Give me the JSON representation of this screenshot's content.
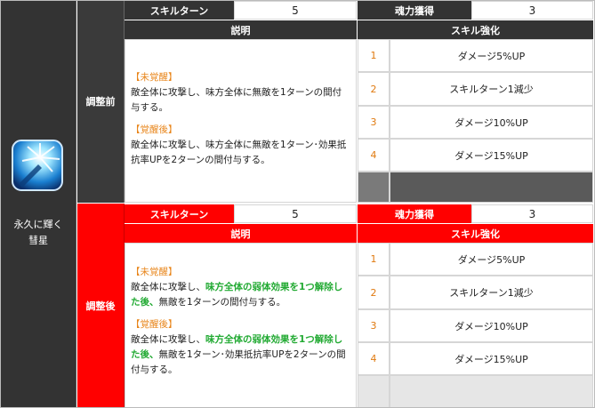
{
  "character": {
    "name_line1": "永久に輝く",
    "name_line2": "彗星"
  },
  "before": {
    "section_label": "調整前",
    "skill_turn_label": "スキルターン",
    "skill_turn_value": "5",
    "soul_gain_label": "魂力獲得",
    "soul_gain_value": "3",
    "desc_header": "説明",
    "boost_header": "スキル強化",
    "desc": {
      "tag1": "【未覚醒】",
      "text1": "敵全体に攻撃し、味方全体に無敵を1ターンの間付与する。",
      "tag2": "【覚醒後】",
      "text2": "敵全体に攻撃し、味方全体に無敵を1ターン･効果抵抗率UPを2ターンの間付与する。"
    },
    "boosts": [
      {
        "num": "1",
        "text": "ダメージ5%UP"
      },
      {
        "num": "2",
        "text": "スキルターン1減少"
      },
      {
        "num": "3",
        "text": "ダメージ10%UP"
      },
      {
        "num": "4",
        "text": "ダメージ15%UP"
      }
    ]
  },
  "after": {
    "section_label": "調整後",
    "skill_turn_label": "スキルターン",
    "skill_turn_value": "5",
    "soul_gain_label": "魂力獲得",
    "soul_gain_value": "3",
    "desc_header": "説明",
    "boost_header": "スキル強化",
    "desc": {
      "tag1": "【未覚醒】",
      "text1_a": "敵全体に攻撃し、",
      "text1_hl": "味方全体の弱体効果を1つ解除した後、",
      "text1_b": "無敵を1ターンの間付与する。",
      "tag2": "【覚醒後】",
      "text2_a": "敵全体に攻撃し、",
      "text2_hl": "味方全体の弱体効果を1つ解除した後、",
      "text2_b": "無敵を1ターン･効果抵抗率UPを2ターンの間付与する。"
    },
    "boosts": [
      {
        "num": "1",
        "text": "ダメージ5%UP"
      },
      {
        "num": "2",
        "text": "スキルターン1減少"
      },
      {
        "num": "3",
        "text": "ダメージ10%UP"
      },
      {
        "num": "4",
        "text": "ダメージ15%UP"
      }
    ]
  },
  "colors": {
    "dark": "#333333",
    "red": "#ff0000",
    "highlight_green": "#22aa33",
    "tag_orange": "#e8851a"
  }
}
